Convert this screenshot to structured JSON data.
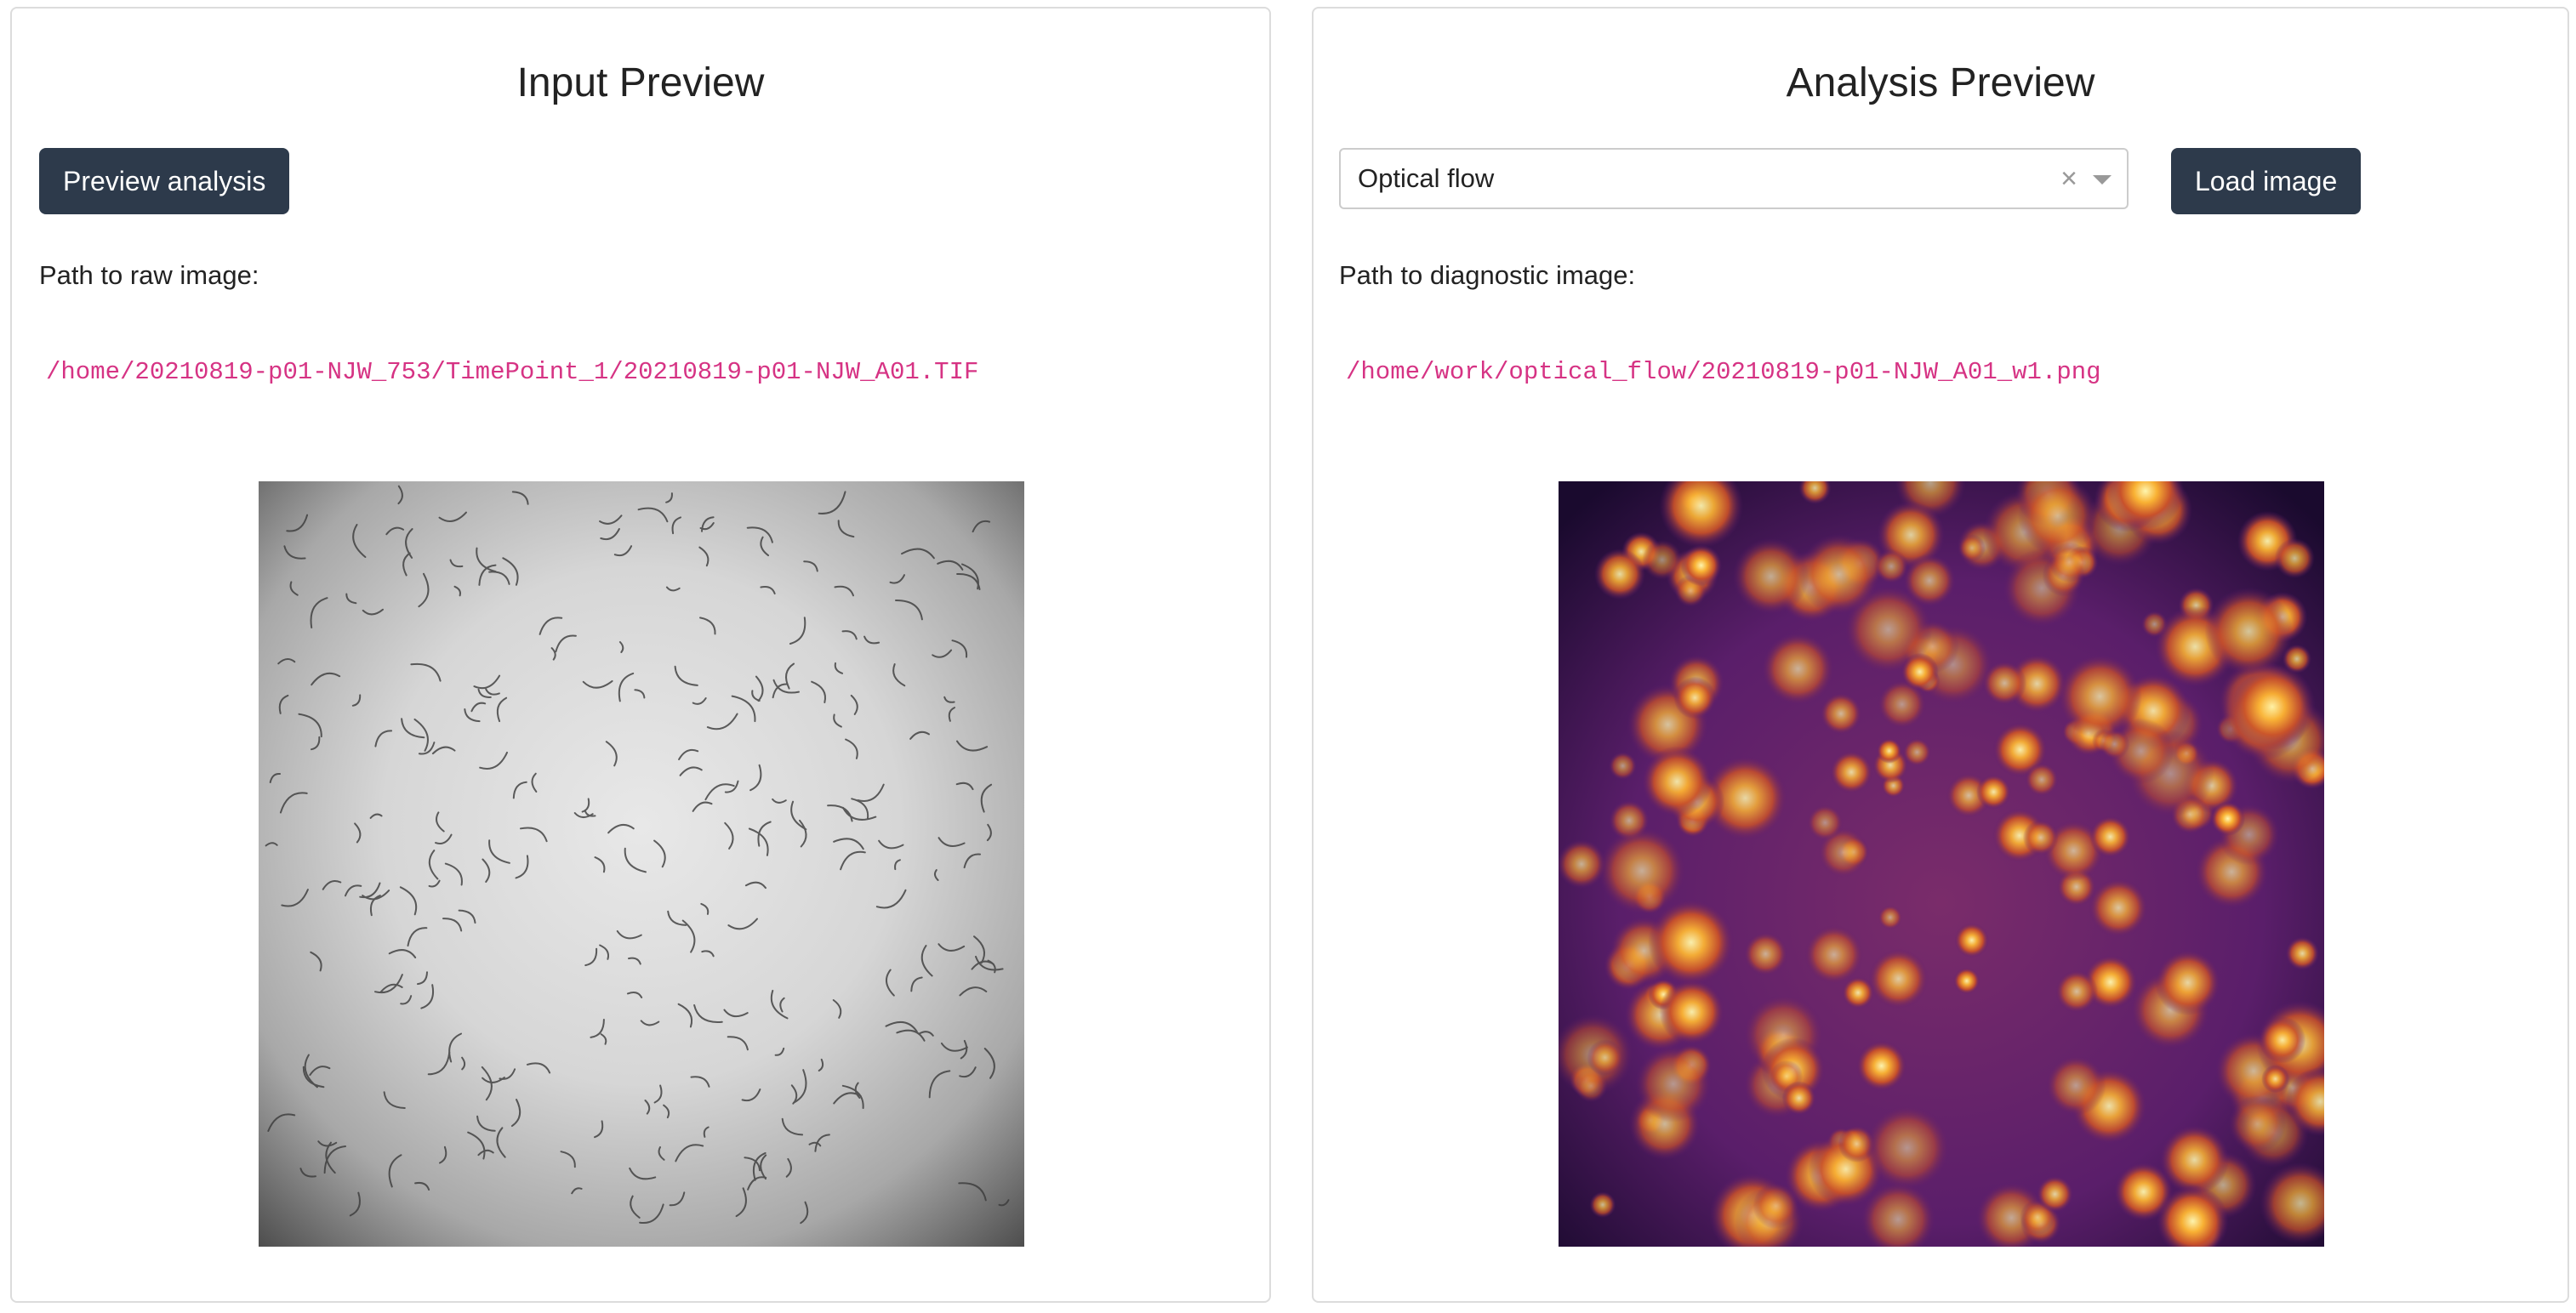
{
  "left_panel": {
    "title": "Input Preview",
    "preview_button": "Preview analysis",
    "path_label": "Path to raw image:",
    "path_value": "/home/20210819-p01-NJW_753/TimePoint_1/20210819-p01-NJW_A01.TIF"
  },
  "right_panel": {
    "title": "Analysis Preview",
    "analysis_select": {
      "selected": "Optical flow",
      "clear_glyph": "×"
    },
    "load_button": "Load image",
    "path_label": "Path to diagnostic image:",
    "path_value": "/home/work/optical_flow/20210819-p01-NJW_A01_w1.png"
  },
  "colors": {
    "button_bg": "#2d3a4b",
    "path_text": "#d63384",
    "card_border": "#dcdcdc"
  }
}
